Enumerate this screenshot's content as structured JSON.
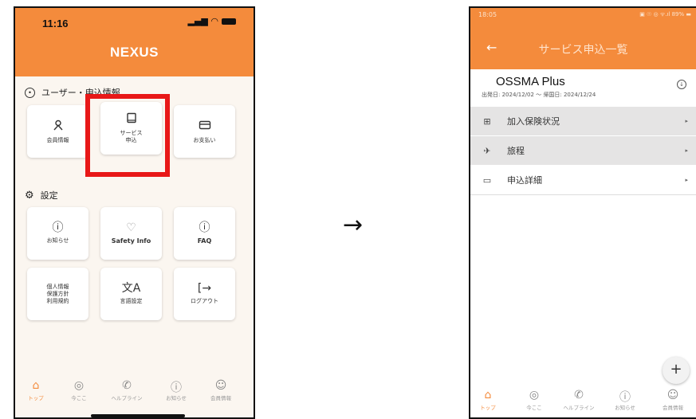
{
  "left_screen": {
    "status_time": "11:16",
    "status_icons": "..ıl ᯤ",
    "app_title": "NEXUS",
    "section_user": {
      "icon": "user-circle-icon",
      "label": "ユーザー・申込情報"
    },
    "user_tiles": [
      {
        "icon": "person",
        "label": "会員情報"
      },
      {
        "icon": "book",
        "label": "サービス\n申込"
      },
      {
        "icon": "card",
        "label": "お支払い"
      }
    ],
    "section_settings": {
      "icon": "gear-icon",
      "label": "設定"
    },
    "settings_tiles": [
      {
        "icon": "info",
        "label": "お知らせ"
      },
      {
        "icon": "heart-hands",
        "label": "Safety Info"
      },
      {
        "icon": "question",
        "label": "FAQ"
      },
      {
        "icon": "none",
        "label": "個人情報\n保護方針\n利用規約"
      },
      {
        "icon": "translate",
        "label": "言語設定"
      },
      {
        "icon": "logout",
        "label": "ログアウト"
      }
    ],
    "nav": [
      "トップ",
      "今ここ",
      "ヘルプライン",
      "お知らせ",
      "会員情報"
    ],
    "highlight_color": "#e81818",
    "accent_color": "#f48b3c"
  },
  "transition_arrow": "→",
  "right_screen": {
    "status_time": "18:05",
    "status_right": "▣ ☉ ◎ ᯤ.ıl 89% ▬",
    "back_icon": "←",
    "title": "サービス申込一覧",
    "plan": {
      "name": "OSSMA Plus",
      "dates": "出発日: 2024/12/02 ～ 帰国日: 2024/12/24"
    },
    "rows": [
      {
        "icon": "plus-box",
        "label": "加入保険状況"
      },
      {
        "icon": "plane",
        "label": "旅程"
      },
      {
        "icon": "book",
        "label": "申込詳細"
      }
    ],
    "fab_label": "+",
    "nav": [
      "トップ",
      "今ここ",
      "ヘルプライン",
      "お知らせ",
      "会員情報"
    ]
  }
}
